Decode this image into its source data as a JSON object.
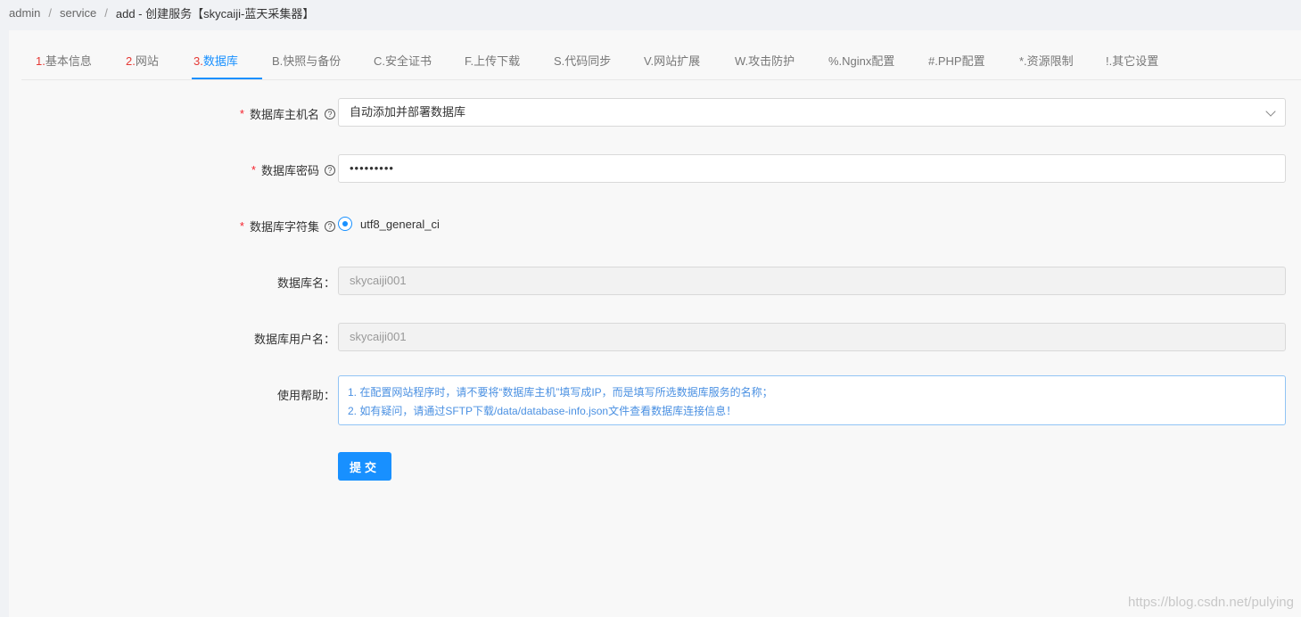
{
  "breadcrumb": {
    "item1": "admin",
    "item2": "service",
    "item3": "add  -  创建服务【skycaiji-蓝天采集器】",
    "separator": "/"
  },
  "tabs": [
    {
      "num": "1.",
      "label": "基本信息"
    },
    {
      "num": "2.",
      "label": "网站"
    },
    {
      "num": "3.",
      "label": "数据库"
    },
    {
      "num": "",
      "label": "B.快照与备份"
    },
    {
      "num": "",
      "label": "C.安全证书"
    },
    {
      "num": "",
      "label": "F.上传下载"
    },
    {
      "num": "",
      "label": "S.代码同步"
    },
    {
      "num": "",
      "label": "V.网站扩展"
    },
    {
      "num": "",
      "label": "W.攻击防护"
    },
    {
      "num": "",
      "label": "%.Nginx配置"
    },
    {
      "num": "",
      "label": "#.PHP配置"
    },
    {
      "num": "",
      "label": "*.资源限制"
    },
    {
      "num": "",
      "label": "!.其它设置"
    }
  ],
  "form": {
    "required_mark": "*",
    "help_icon_char": "?",
    "host": {
      "label": "数据库主机名",
      "value": "自动添加并部署数据库"
    },
    "password": {
      "label": "数据库密码",
      "value": "•••••••••"
    },
    "charset": {
      "label": "数据库字符集",
      "option": "utf8_general_ci"
    },
    "dbname": {
      "label": "数据库名：",
      "value": "skycaiji001"
    },
    "dbuser": {
      "label": "数据库用户名：",
      "value": "skycaiji001"
    },
    "help": {
      "label": "使用帮助：",
      "line1": "1. 在配置网站程序时，请不要将“数据库主机”填写成IP，而是填写所选数据库服务的名称；",
      "line2": "2. 如有疑问，请通过SFTP下载/data/database-info.json文件查看数据库连接信息！"
    },
    "submit": "提交"
  },
  "watermark": "https://blog.csdn.net/pulying",
  "colors": {
    "accent": "#1890ff",
    "required": "#f5222d",
    "tab_number": "#e53935"
  }
}
